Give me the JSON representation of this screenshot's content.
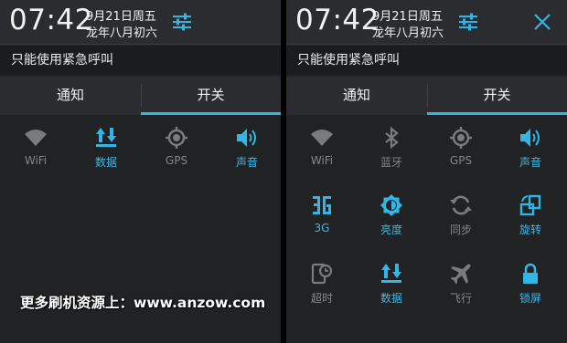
{
  "colors": {
    "accent": "#33b5e5",
    "panel_bg": "#212224",
    "header_bg": "#2b2c2f",
    "inactive": "#858689"
  },
  "left": {
    "time": "07:42",
    "date_line1": "9月21日周五",
    "date_line2": "龙年八月初六",
    "emergency_text": "只能使用紧急呼叫",
    "tabs": [
      "通知",
      "开关"
    ],
    "toggles": [
      {
        "label": "WiFi",
        "icon": "wifi-icon",
        "active": false
      },
      {
        "label": "数据",
        "icon": "data-icon",
        "active": true
      },
      {
        "label": "GPS",
        "icon": "gps-icon",
        "active": false
      },
      {
        "label": "声音",
        "icon": "sound-icon",
        "active": true
      }
    ]
  },
  "right": {
    "time": "07:42",
    "date_line1": "9月21日周五",
    "date_line2": "龙年八月初六",
    "emergency_text": "只能使用紧急呼叫",
    "tabs": [
      "通知",
      "开关"
    ],
    "toggles": [
      {
        "label": "WiFi",
        "icon": "wifi-icon",
        "active": false
      },
      {
        "label": "蓝牙",
        "icon": "bluetooth-icon",
        "active": false
      },
      {
        "label": "GPS",
        "icon": "gps-icon",
        "active": false
      },
      {
        "label": "声音",
        "icon": "sound-icon",
        "active": true
      },
      {
        "label": "3G",
        "icon": "3g-icon",
        "active": true
      },
      {
        "label": "亮度",
        "icon": "brightness-icon",
        "active": true
      },
      {
        "label": "同步",
        "icon": "sync-icon",
        "active": false
      },
      {
        "label": "旋转",
        "icon": "rotate-icon",
        "active": true
      },
      {
        "label": "超时",
        "icon": "timeout-icon",
        "active": false
      },
      {
        "label": "数据",
        "icon": "data-icon",
        "active": true
      },
      {
        "label": "飞行",
        "icon": "airplane-icon",
        "active": false
      },
      {
        "label": "锁屏",
        "icon": "lock-icon",
        "active": true
      }
    ]
  },
  "watermark": "更多刷机资源上：www.anzow.com"
}
